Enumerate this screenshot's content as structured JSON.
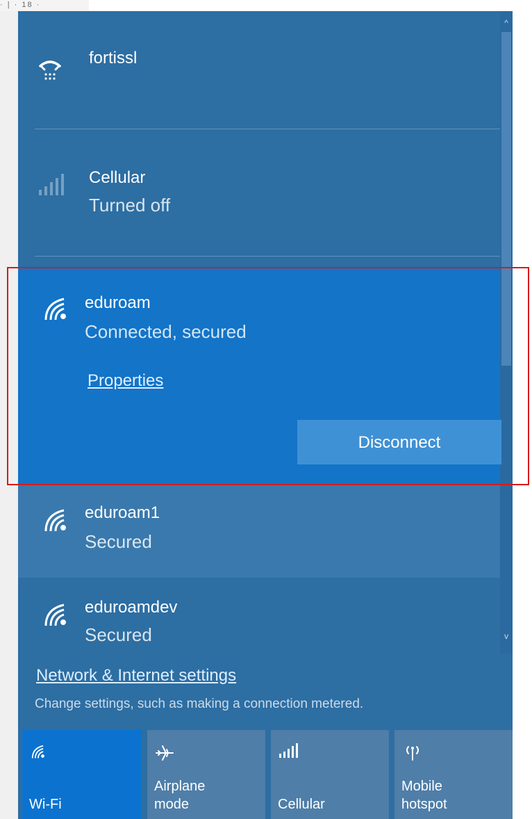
{
  "ruler": {
    "text": "· | · 18 ·"
  },
  "networks": [
    {
      "name": "fortissl",
      "status": "",
      "icon": "dial-up-phone-icon"
    },
    {
      "name": "Cellular",
      "status": "Turned off",
      "icon": "cellular-signal-icon"
    },
    {
      "name": "eduroam",
      "status": "Connected, secured",
      "icon": "wifi-icon"
    },
    {
      "name": "eduroam1",
      "status": "Secured",
      "icon": "wifi-icon"
    },
    {
      "name": "eduroamdev",
      "status": "Secured",
      "icon": "wifi-icon"
    }
  ],
  "selected": {
    "properties_label": "Properties",
    "disconnect_label": "Disconnect"
  },
  "settings": {
    "link_label": "Network & Internet settings",
    "description": "Change settings, such as making a connection metered."
  },
  "quick_actions": [
    {
      "label_line1": "",
      "label_line2": "Wi-Fi",
      "icon": "wifi-icon",
      "active": true
    },
    {
      "label_line1": "Airplane",
      "label_line2": "mode",
      "icon": "airplane-icon",
      "active": false
    },
    {
      "label_line1": "",
      "label_line2": "Cellular",
      "icon": "cellular-signal-icon",
      "active": false
    },
    {
      "label_line1": "Mobile",
      "label_line2": "hotspot",
      "icon": "mobile-hotspot-icon",
      "active": false
    }
  ],
  "colors": {
    "panel_background": "#2d6ea3",
    "selected_background": "#1374c8",
    "active_tile": "#0b73cf",
    "inactive_tile": "#4f7ea8",
    "highlight_frame": "#d81b1b"
  }
}
